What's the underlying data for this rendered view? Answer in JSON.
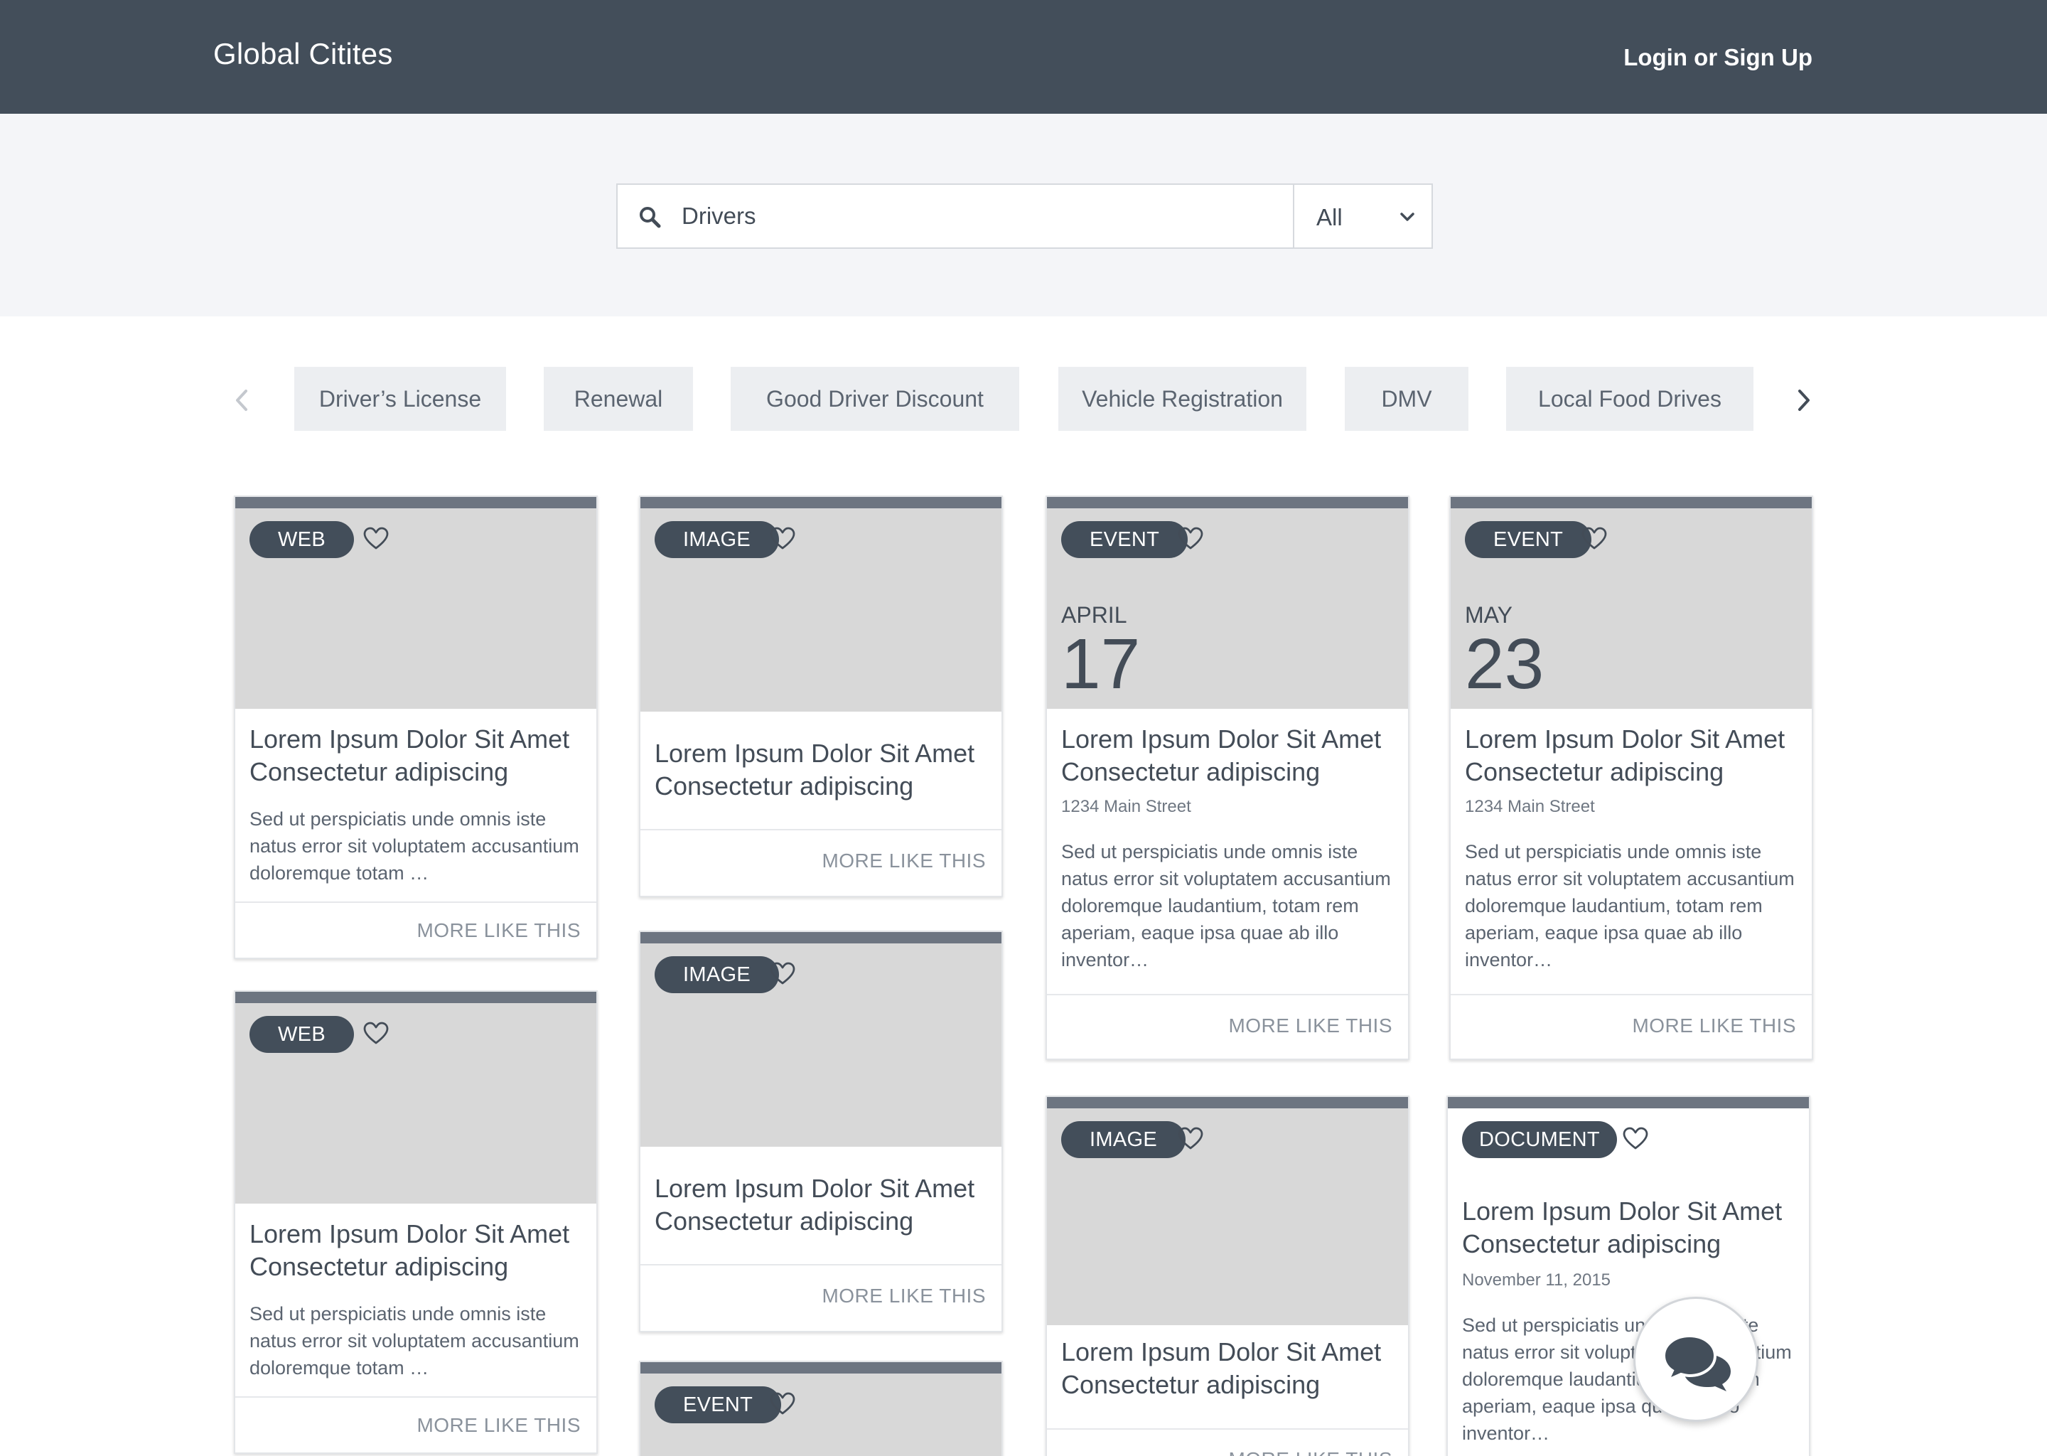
{
  "header": {
    "brand": "Global Citites",
    "login": "Login or Sign Up"
  },
  "search": {
    "value": "Drivers",
    "filter": "All"
  },
  "tags": [
    "Driver’s License",
    "Renewal",
    "Good Driver Discount",
    "Vehicle Registration",
    "DMV",
    "Local Food Drives"
  ],
  "cards": [
    {
      "badge": "WEB",
      "title": "Lorem Ipsum Dolor Sit Amet Consectetur adipiscing",
      "desc": "Sed ut perspiciatis unde omnis iste natus error sit voluptatem accusantium doloremque totam …",
      "more": "MORE LIKE THIS"
    },
    {
      "badge": "WEB",
      "title": "Lorem Ipsum Dolor Sit Amet Consectetur adipiscing",
      "desc": "Sed ut perspiciatis unde omnis iste natus error sit voluptatem accusantium doloremque totam …",
      "more": "MORE LIKE THIS"
    },
    {
      "badge": "IMAGE",
      "title": "Lorem Ipsum Dolor Sit Amet Consectetur adipiscing",
      "more": "MORE LIKE THIS"
    },
    {
      "badge": "IMAGE",
      "title": "Lorem Ipsum Dolor Sit Amet Consectetur adipiscing",
      "more": "MORE LIKE THIS"
    },
    {
      "badge": "EVENT"
    },
    {
      "badge": "EVENT",
      "month": "APRIL",
      "day": "17",
      "title": "Lorem Ipsum Dolor Sit Amet Consectetur adipiscing",
      "meta": "1234 Main Street",
      "desc": "Sed ut perspiciatis unde omnis iste natus error sit voluptatem accusantium doloremque laudantium, totam rem aperiam, eaque ipsa quae ab illo inventor…",
      "more": "MORE LIKE THIS"
    },
    {
      "badge": "IMAGE",
      "title": "Lorem Ipsum Dolor Sit Amet Consectetur adipiscing",
      "more": "MORE LIKE THIS"
    },
    {
      "badge": "EVENT",
      "month": "MAY",
      "day": "23",
      "title": "Lorem Ipsum Dolor Sit Amet Consectetur adipiscing",
      "meta": "1234 Main Street",
      "desc": "Sed ut perspiciatis unde omnis iste natus error sit voluptatem accusantium doloremque laudantium, totam rem aperiam, eaque ipsa quae ab illo inventor…",
      "more": "MORE LIKE THIS"
    },
    {
      "badge": "DOCUMENT",
      "title": "Lorem Ipsum Dolor Sit Amet Consectetur adipiscing",
      "meta": "November 11, 2015",
      "desc": "Sed ut perspiciatis unde omnis iste natus error sit voluptatem accusantium doloremque laudantium, totam rem aperiam, eaque ipsa quae ab illo inventor…"
    }
  ]
}
